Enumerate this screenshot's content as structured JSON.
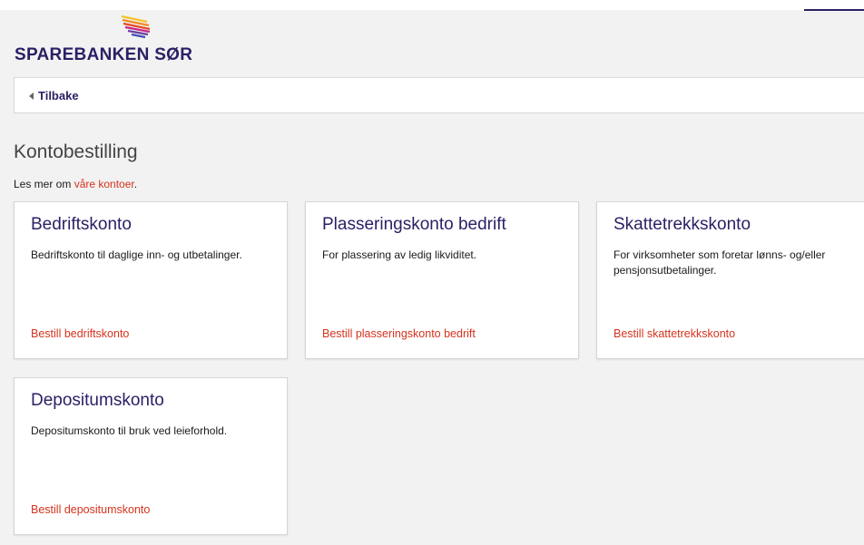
{
  "brand": {
    "name": "SPAREBANKEN SØR",
    "colors": {
      "primary": "#2b1f65",
      "accent": "#d6321e",
      "logo_stripes": [
        "#f5c22b",
        "#f08a24",
        "#e44b2a",
        "#c4268a",
        "#6a3fa0",
        "#3d4fb8"
      ]
    }
  },
  "nav": {
    "back_label": "Tilbake"
  },
  "page": {
    "title": "Kontobestilling",
    "intro_prefix": "Les mer om ",
    "intro_link": "våre kontoer",
    "intro_suffix": "."
  },
  "accounts": [
    {
      "title": "Bedriftskonto",
      "description": "Bedriftskonto til daglige inn- og utbetalinger.",
      "link": "Bestill bedriftskonto"
    },
    {
      "title": "Plasseringskonto bedrift",
      "description": "For plassering av ledig likviditet.",
      "link": "Bestill plasseringskonto bedrift"
    },
    {
      "title": "Skattetrekkskonto",
      "description": "For virksomheter som foretar lønns- og/eller pensjonsutbetalinger.",
      "link": "Bestill skattetrekkskonto"
    },
    {
      "title": "Depositumskonto",
      "description": "Depositumskonto til bruk ved leieforhold.",
      "link": "Bestill depositumskonto"
    }
  ]
}
